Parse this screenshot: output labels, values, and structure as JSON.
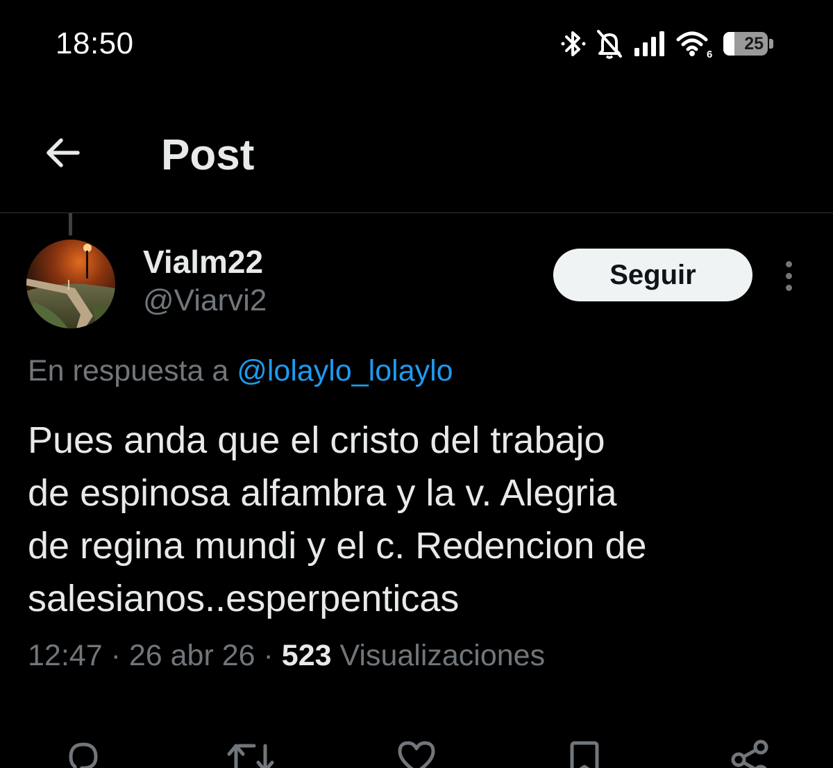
{
  "status_bar": {
    "time": "18:50",
    "battery_level": "25",
    "battery_fraction": 0.25,
    "wifi_badge": "6",
    "icons": [
      "bluetooth-icon",
      "bell-off-icon",
      "signal-icon",
      "wifi-icon",
      "battery-icon"
    ]
  },
  "header": {
    "title": "Post",
    "back_icon": "arrow-left-icon"
  },
  "post": {
    "author_name": "Vialm22",
    "author_handle": "@Viarvi2",
    "follow_label": "Seguir",
    "reply_prefix": "En respuesta a",
    "reply_handle": "@lolaylo_lolaylo",
    "text": "Pues anda que el cristo del trabajo\nde espinosa alfambra y la v. Alegria\nde regina mundi y el c. Redencion de\nsalesianos..esperpenticas",
    "time": "12:47",
    "date": "26 abr 26",
    "separator": "·",
    "views_count": "523",
    "views_label": "Visualizaciones"
  },
  "actions": [
    "reply-icon",
    "repost-icon",
    "like-icon",
    "bookmark-icon",
    "share-icon"
  ],
  "colors": {
    "background": "#000000",
    "text_primary": "#e7e9ea",
    "text_secondary": "#71767b",
    "link": "#1d9bf0",
    "follow_bg": "#eff3f4",
    "divider": "#2f3336"
  }
}
